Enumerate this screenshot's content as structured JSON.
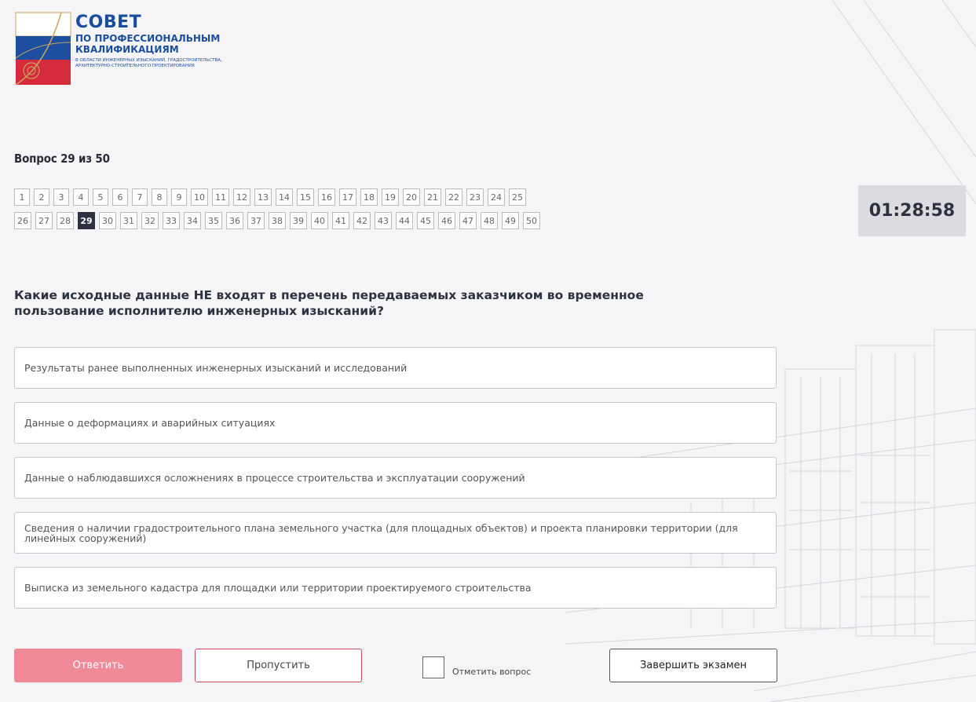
{
  "logo": {
    "title": "СОВЕТ",
    "line2": "ПО ПРОФЕССИОНАЛЬНЫМ",
    "line3": "КВАЛИФИКАЦИЯМ",
    "line4": "В ОБЛАСТИ ИНЖЕНЕРНЫХ ИЗЫСКАНИЙ, ГРАДОСТРОИТЕЛЬСТВА, АРХИТЕКТУРНО-СТРОИТЕЛЬНОГО ПРОЕКТИРОВАНИЯ"
  },
  "question_counter": "Вопрос 29 из 50",
  "current_question": 29,
  "timer": "01:28:58",
  "question_text": "Какие исходные данные НЕ входят в перечень передаваемых заказчиком во временное пользование исполнителю инженерных изысканий?",
  "answers": [
    "Результаты ранее выполненных инженерных изысканий и исследований",
    "Данные о деформациях и аварийных ситуациях",
    "Данные о наблюдавшихся осложнениях в процессе строительства и эксплуатации сооружений",
    "Сведения о наличии градостроительного плана земельного участка (для площадных объектов) и проекта планировки территории (для линейных сооружений)",
    "Выписка из земельного кадастра для площадки или территории проектируемого строительства"
  ],
  "buttons": {
    "answer": "Ответить",
    "skip": "Пропустить",
    "mark": "Отметить вопрос",
    "finish": "Завершить экзамен"
  },
  "colors": {
    "answer_button": "#f08a99",
    "skip_border": "#c94a5a",
    "active_number": "#2d3142",
    "timer_bg": "#dcdce0",
    "logo_blue": "#1a4e9c"
  }
}
